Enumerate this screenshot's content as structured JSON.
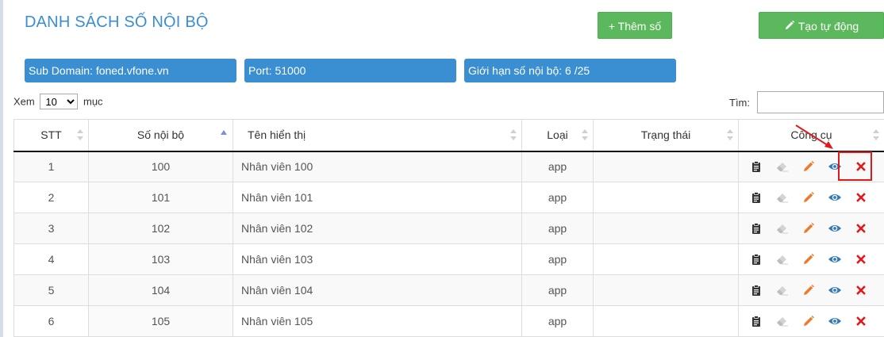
{
  "page": {
    "title": "DANH SÁCH SỐ NỘI BỘ"
  },
  "buttons": {
    "add_label": "+ Thêm số",
    "auto_label": "Tạo tự động",
    "auto_icon": "pencil-icon"
  },
  "info": {
    "subdomain_label": "Sub Domain:",
    "subdomain_value": "foned.vfone.vn",
    "port_label": "Port:",
    "port_value": "51000",
    "limit_label": "Giới hạn số nội bộ:",
    "limit_value": "6 /25"
  },
  "length": {
    "prefix": "Xem",
    "selected": "10",
    "suffix": "mục"
  },
  "search": {
    "label": "Tìm:",
    "value": ""
  },
  "table": {
    "columns": [
      "STT",
      "Số nội bộ",
      "Tên hiển thị",
      "Loại",
      "Trạng thái",
      "Công cụ"
    ],
    "rows": [
      {
        "stt": "1",
        "number": "100",
        "name": "Nhân viên 100",
        "type": "app",
        "status": ""
      },
      {
        "stt": "2",
        "number": "101",
        "name": "Nhân viên 101",
        "type": "app",
        "status": ""
      },
      {
        "stt": "3",
        "number": "102",
        "name": "Nhân viên 102",
        "type": "app",
        "status": ""
      },
      {
        "stt": "4",
        "number": "103",
        "name": "Nhân viên 103",
        "type": "app",
        "status": ""
      },
      {
        "stt": "5",
        "number": "104",
        "name": "Nhân viên 104",
        "type": "app",
        "status": ""
      },
      {
        "stt": "6",
        "number": "105",
        "name": "Nhân viên 105",
        "type": "app",
        "status": ""
      }
    ],
    "tool_icons": [
      "clipboard-icon",
      "eraser-icon",
      "pencil-icon",
      "eye-icon",
      "close-icon"
    ]
  },
  "colors": {
    "title": "#3a8ed2",
    "info_bg": "#3a8ed2",
    "button_green": "#5cb85c",
    "clipboard": "#333333",
    "eraser": "#cccccc",
    "pencil": "#f0782b",
    "eye": "#337ab7",
    "close": "#e01a1a",
    "annotation": "#e01a1a"
  }
}
